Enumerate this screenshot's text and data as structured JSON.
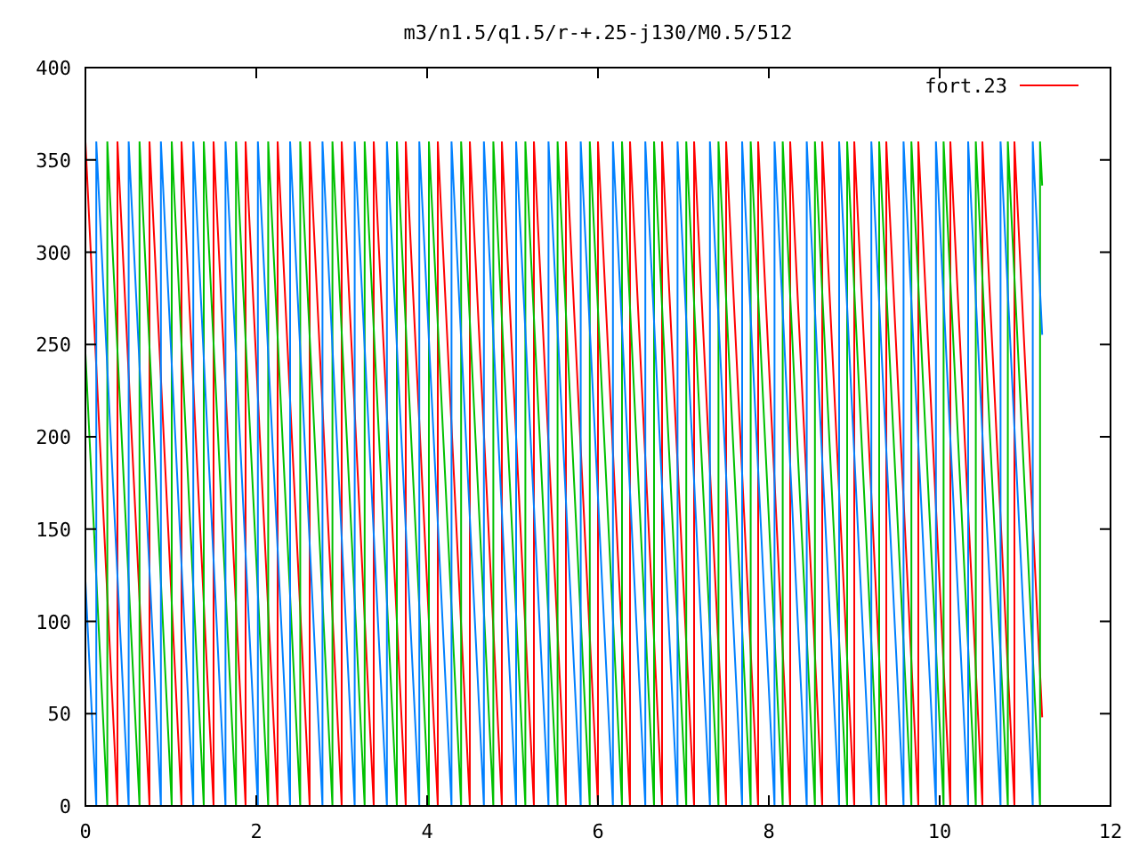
{
  "title": "m3/n1.5/q1.5/r-+.25-j130/M0.5/512",
  "legend": [
    {
      "label": "fort.23",
      "color": "#ff0000"
    }
  ],
  "x_axis": {
    "ticks": [
      "0",
      "2",
      "4",
      "6",
      "8",
      "10",
      "12"
    ]
  },
  "y_axis": {
    "ticks": [
      "400",
      "350",
      "300",
      "250",
      "200",
      "150",
      "100",
      "50",
      "0"
    ]
  },
  "traces": [
    {
      "color": "#ff0000"
    },
    {
      "color": "#00c000"
    },
    {
      "color": "#0080ff"
    }
  ]
}
